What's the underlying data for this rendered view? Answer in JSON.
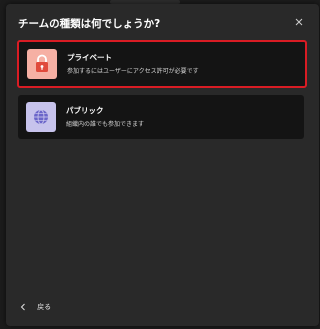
{
  "dialog": {
    "title": "チームの種類は何でしょうか?",
    "close_icon": "close-icon",
    "back_label": "戻る"
  },
  "options": [
    {
      "title": "プライベート",
      "description": "参加するにはユーザーにアクセス許可が必要です",
      "icon": "lock-icon",
      "icon_bg": "#f6b0a4",
      "icon_fg": "#e04a3c",
      "selected": true
    },
    {
      "title": "パブリック",
      "description": "組織内の誰でも参加できます",
      "icon": "globe-icon",
      "icon_bg": "#c7c3ec",
      "icon_fg": "#6b66c9",
      "selected": false
    }
  ],
  "colors": {
    "selection_border": "#d91c24",
    "dialog_bg": "#292929",
    "option_bg": "#141414"
  }
}
